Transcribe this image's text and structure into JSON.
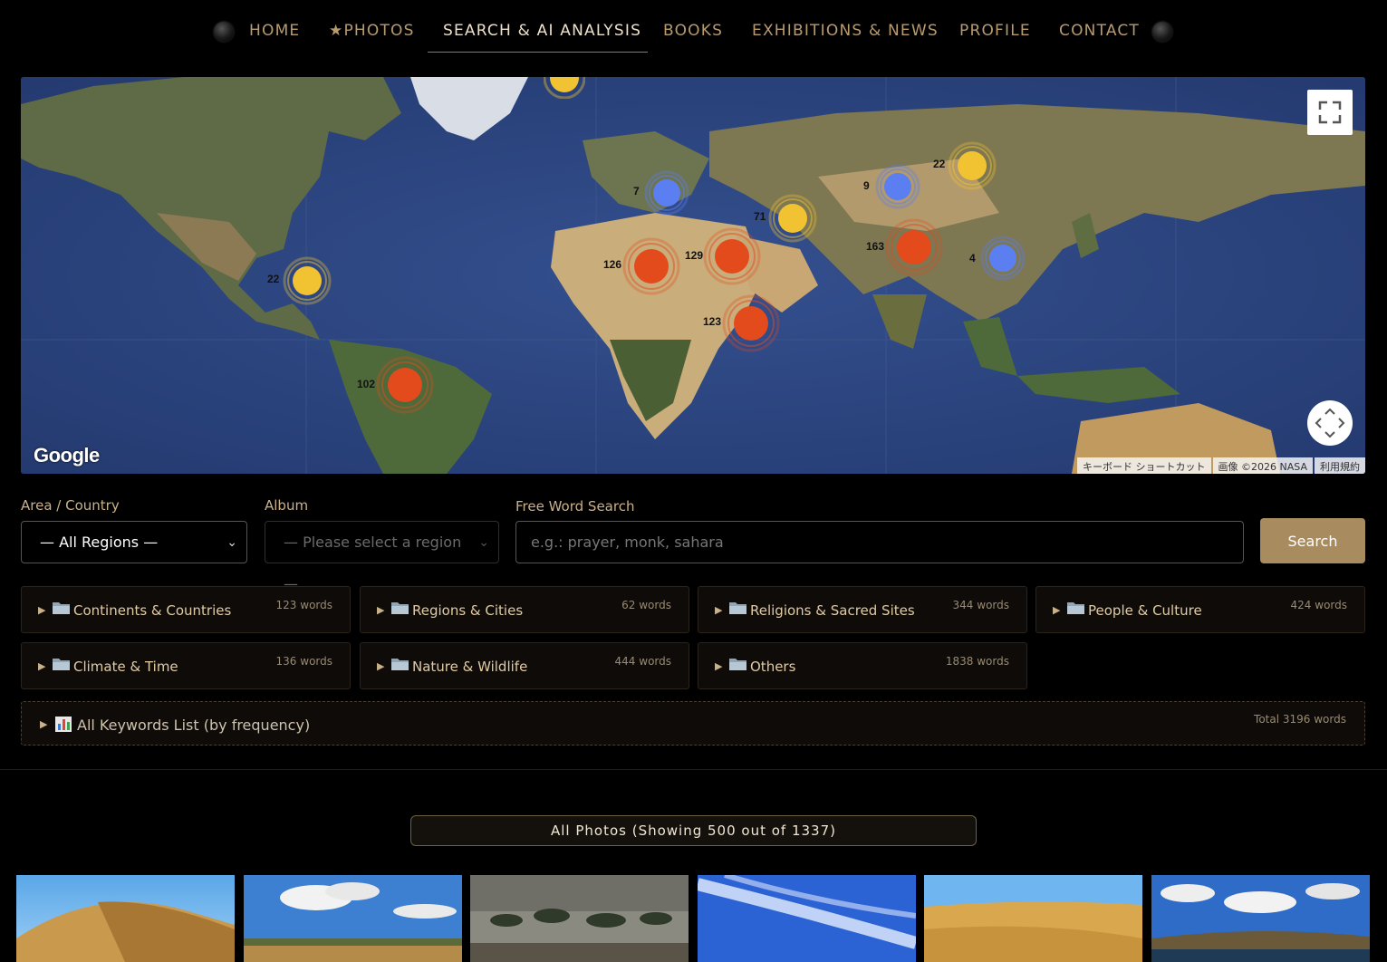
{
  "nav": {
    "items": [
      {
        "label": "HOME",
        "active": false
      },
      {
        "label": "★PHOTOS",
        "active": false
      },
      {
        "label": "SEARCH & AI ANALYSIS",
        "active": true
      },
      {
        "label": "BOOKS",
        "active": false
      },
      {
        "label": "EXHIBITIONS & NEWS",
        "active": false
      },
      {
        "label": "PROFILE",
        "active": false
      },
      {
        "label": "CONTACT",
        "active": false
      }
    ]
  },
  "map": {
    "logo": "Google",
    "attribution": [
      "キーボード ショートカット",
      "画像 ©2026 NASA",
      "利用規約"
    ],
    "clusters": [
      {
        "count": "7",
        "color": "#5b7ff0"
      },
      {
        "count": "9",
        "color": "#5b7ff0"
      },
      {
        "count": "22",
        "color": "#f1c232"
      },
      {
        "count": "71",
        "color": "#f1c232"
      },
      {
        "count": "22",
        "color": "#f1c232"
      },
      {
        "count": "126",
        "color": "#e34a1c"
      },
      {
        "count": "129",
        "color": "#e34a1c"
      },
      {
        "count": "163",
        "color": "#e34a1c"
      },
      {
        "count": "4",
        "color": "#5b7ff0"
      },
      {
        "count": "123",
        "color": "#e34a1c"
      },
      {
        "count": "102",
        "color": "#e34a1c"
      }
    ],
    "colors": {
      "ocean": "#2f4a86",
      "land": "#6a6d4a",
      "desert": "#c9ad7a"
    }
  },
  "filters": {
    "area_label": "Area / Country",
    "area_value": "— All Regions —",
    "album_label": "Album",
    "album_value": "— Please select a region —",
    "freeword_label": "Free Word Search",
    "freeword_placeholder": "e.g.: prayer, monk, sahara",
    "search_button": "Search"
  },
  "categories": [
    {
      "title": "Continents & Countries",
      "count": "123 words"
    },
    {
      "title": "Regions & Cities",
      "count": "62 words"
    },
    {
      "title": "Religions & Sacred Sites",
      "count": "344 words"
    },
    {
      "title": "People & Culture",
      "count": "424 words"
    },
    {
      "title": "Climate & Time",
      "count": "136 words"
    },
    {
      "title": "Nature & Wildlife",
      "count": "444 words"
    },
    {
      "title": "Others",
      "count": "1838 words"
    }
  ],
  "all_keywords": {
    "title": "All Keywords List (by frequency)",
    "count": "Total 3196 words"
  },
  "photos": {
    "heading": "All Photos (Showing 500 out of 1337)",
    "thumbnails": [
      {
        "icon": "desert-dune-photo"
      },
      {
        "icon": "desert-oasis-clouds-photo"
      },
      {
        "icon": "palm-grove-photo"
      },
      {
        "icon": "blue-sky-clouds-photo"
      },
      {
        "icon": "golden-dune-photo"
      },
      {
        "icon": "oasis-lake-photo"
      }
    ]
  },
  "accent_color": "#a88b5e"
}
